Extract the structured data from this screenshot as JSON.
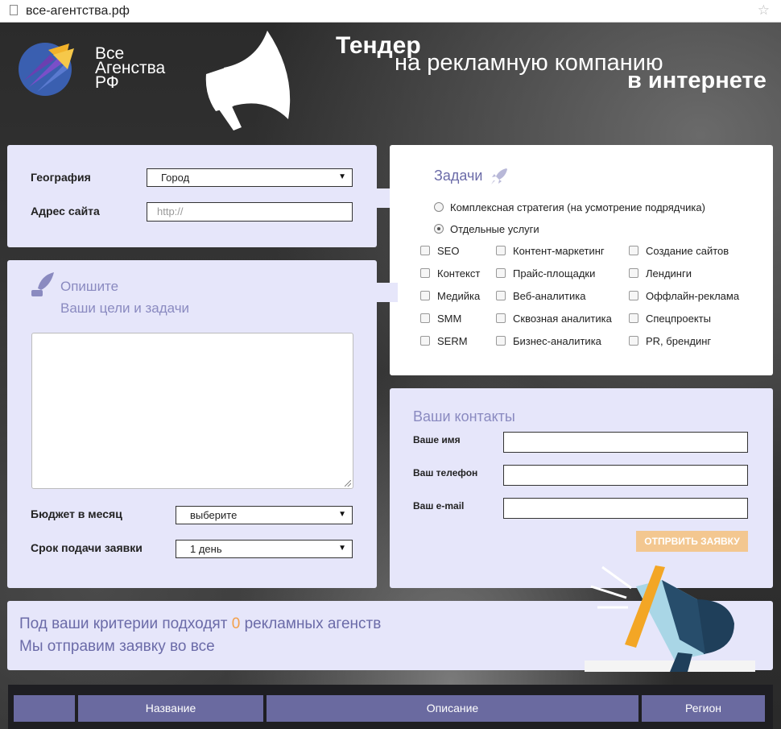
{
  "browser": {
    "url": "все-агентства.рф"
  },
  "logo": {
    "line1": "Все",
    "line2": "Агенства",
    "line3": "РФ"
  },
  "header": {
    "title_line1": "Тендер",
    "title_line2": "на рекламную компанию",
    "title_line3": "в интернете"
  },
  "geo_panel": {
    "geography_label": "География",
    "geography_value": "Город",
    "site_label": "Адрес сайта",
    "site_placeholder": "http://"
  },
  "tasks": {
    "title": "Задачи",
    "radio_options": [
      {
        "label": "Комплексная стратегия (на усмотрение подрядчика)",
        "selected": false
      },
      {
        "label": "Отдельные услуги",
        "selected": true
      }
    ],
    "services": [
      "SEO",
      "Контент-маркетинг",
      "Создание сайтов",
      "Контекст",
      "Прайс-площадки",
      "Лендинги",
      "Медийка",
      "Веб-аналитика",
      "Оффлайн-реклама",
      "SMM",
      "Сквозная аналитика",
      "Спецпроекты",
      "SERM",
      "Бизнес-аналитика",
      "PR, брендинг"
    ]
  },
  "describe": {
    "title_line1": "Опишите",
    "title_line2": "Ваши цели и задачи",
    "budget_label": "Бюджет в месяц",
    "budget_value": "выберите",
    "deadline_label": "Срок подачи заявки",
    "deadline_value": "1 день"
  },
  "contacts": {
    "title": "Ваши контакты",
    "name_label": "Ваше имя",
    "phone_label": "Ваш телефон",
    "email_label": "Ваш e-mail",
    "submit_label": "ОТПРВИТЬ ЗАЯВКУ"
  },
  "result": {
    "line1_prefix": "Под ваши критерии подходят",
    "count": "0",
    "line1_suffix": "рекламных агенств",
    "line2": "Мы отправим заявку во все"
  },
  "table": {
    "columns": [
      "",
      "Название",
      "Описание",
      "Регион"
    ]
  },
  "colors": {
    "panel": "#e6e6fa",
    "accent": "#6b6ba8",
    "button": "#f3c790",
    "count": "#f3a04a"
  }
}
